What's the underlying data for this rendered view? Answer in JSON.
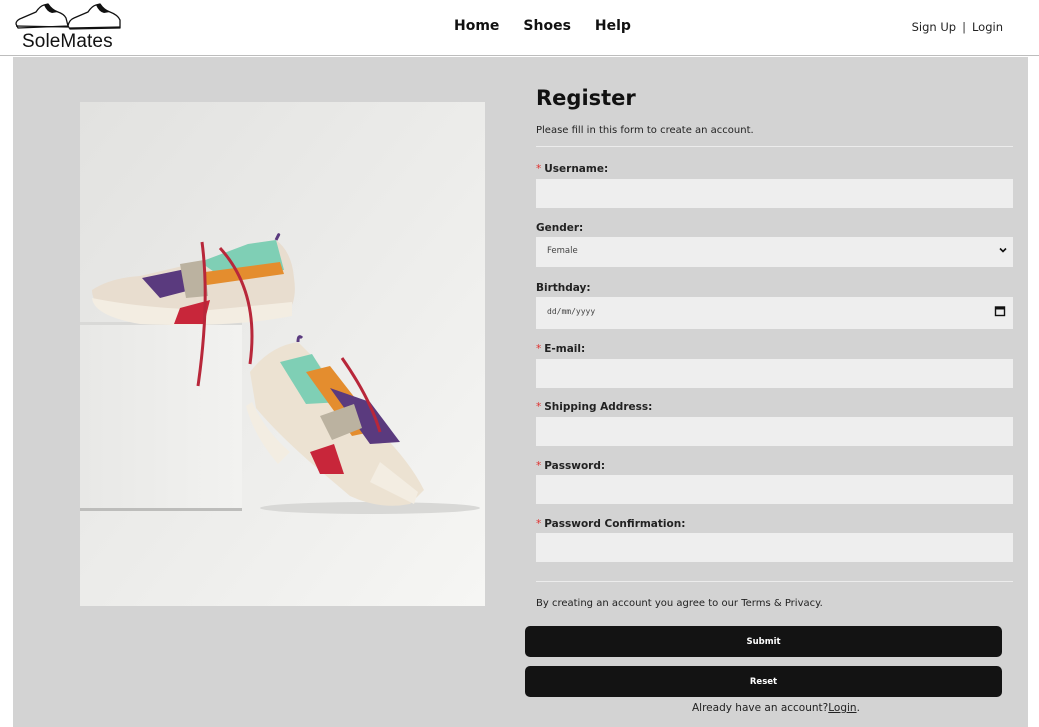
{
  "brand": {
    "name": "SoleMates"
  },
  "nav": {
    "items": [
      {
        "label": "Home"
      },
      {
        "label": "Shoes"
      },
      {
        "label": "Help"
      }
    ]
  },
  "auth": {
    "signup": "Sign Up",
    "separator": "|",
    "login": "Login"
  },
  "form": {
    "title": "Register",
    "subtitle": "Please fill in this form to create an account.",
    "required_marker": "*",
    "fields": {
      "username": {
        "label": "Username:",
        "value": ""
      },
      "gender": {
        "label": "Gender:",
        "value": "Female"
      },
      "birthday": {
        "label": "Birthday:",
        "placeholder": "dd/mm/yyyy"
      },
      "email": {
        "label": "E-mail:",
        "value": ""
      },
      "shipping": {
        "label": "Shipping Address:",
        "value": ""
      },
      "password": {
        "label": "Password:",
        "value": ""
      },
      "password_confirm": {
        "label": "Password Confirmation:",
        "value": ""
      }
    },
    "terms": "By creating an account you agree to our Terms & Privacy.",
    "submit": "Submit",
    "reset": "Reset",
    "already": "Already have an account?",
    "login_link": "Login",
    "login_period": "."
  },
  "colors": {
    "required": "#e0302e",
    "button": "#131313",
    "panel": "#d3d3d3",
    "field": "#eeeeee"
  },
  "icons": {
    "logo": "sneakers-logo-icon",
    "select": "chevron-down-icon",
    "date": "calendar-icon"
  }
}
